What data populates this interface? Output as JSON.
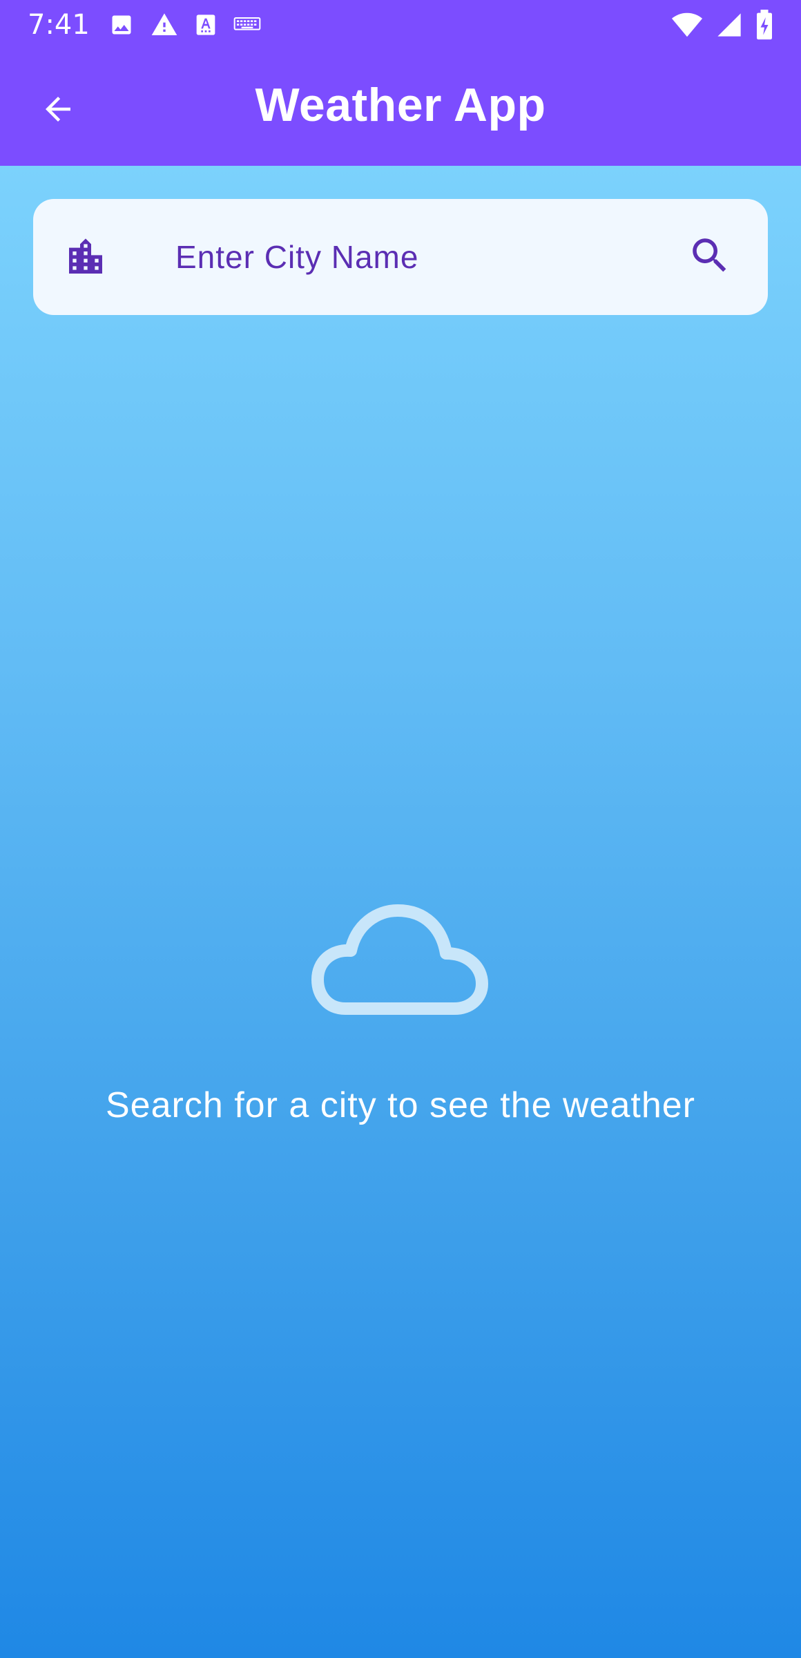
{
  "status_bar": {
    "time": "7:41",
    "left_icons": [
      "image-icon",
      "warning-icon",
      "text-a-icon",
      "keyboard-icon"
    ],
    "right_icons": [
      "wifi-icon",
      "signal-icon",
      "battery-charging-icon"
    ]
  },
  "app_bar": {
    "title": "Weather App",
    "back_icon": "arrow-back-icon",
    "background_color": "#7C4DFF"
  },
  "search": {
    "placeholder": "Enter City Name",
    "value": "",
    "leading_icon": "city-icon",
    "trailing_icon": "search-icon",
    "accent_color": "#5B2EB3"
  },
  "empty_state": {
    "icon": "cloud-icon",
    "message": "Search for a city to see the weather"
  },
  "colors": {
    "gradient_top": "#84D9FF",
    "gradient_bottom": "#1F88E5",
    "card_background": "#F1F8FF"
  }
}
